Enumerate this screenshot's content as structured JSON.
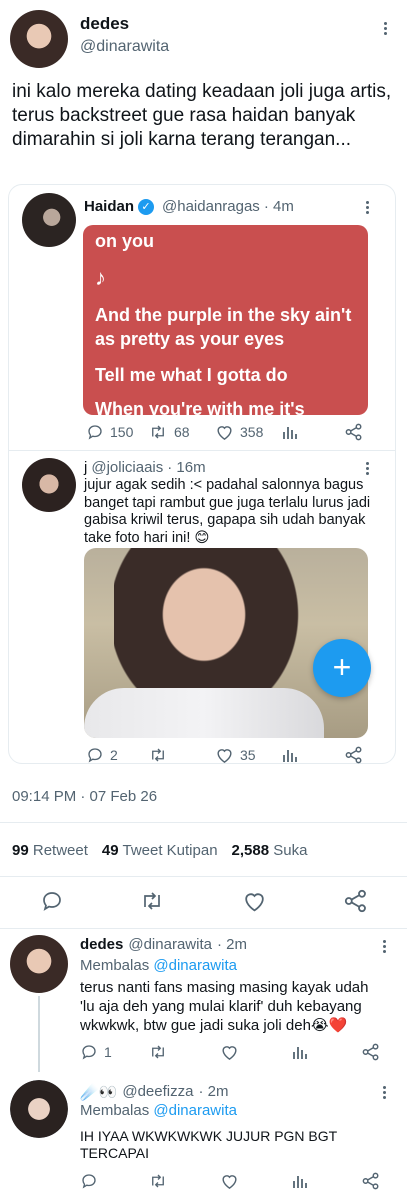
{
  "main_tweet": {
    "author_name": "dedes",
    "author_handle": "@dinarawita",
    "text": "ini kalo mereka dating keadaan joli juga artis, terus backstreet gue rasa haidan banyak dimarahin si joli karna terang terangan..."
  },
  "quote_card": {
    "tweet_1": {
      "author_name": "Haidan",
      "verified_icon": "verified-badge-icon",
      "author_handle": "@haidanragas",
      "time": "· 4m",
      "lyrics": [
        "on you",
        "♪",
        "And the purple in the sky ain't",
        "as pretty as your eyes",
        "Tell me what I gotta do",
        "When you're with me it's"
      ],
      "replies": "150",
      "retweets": "68",
      "likes": "358"
    },
    "tweet_2": {
      "author_name": "j",
      "author_handle": "@joliciaais",
      "time": "· 16m",
      "text": "jujur agak sedih :< padahal salonnya bagus banget tapi rambut gue juga terlalu lurus jadi gabisa kriwil terus, gapapa sih udah banyak take foto hari ini! 😊",
      "replies": "2",
      "likes": "35"
    }
  },
  "meta": {
    "timestamp": "09:14 PM · 07 Feb 26"
  },
  "stats": {
    "retweets_count": "99",
    "retweets_label": "Retweet",
    "quotes_count": "49",
    "quotes_label": "Tweet Kutipan",
    "likes_count": "2,588",
    "likes_label": "Suka"
  },
  "replies": [
    {
      "author_name": "dedes",
      "author_handle": "@dinarawita",
      "time": "· 2m",
      "replying_label": "Membalas",
      "replying_to": "@dinarawita",
      "text": "terus nanti fans masing masing kayak udah 'lu aja deh yang mulai klarif' duh kebayang wkwkwk, btw gue jadi suka joli deh😭❤️",
      "replies": "1"
    },
    {
      "author_name": "☄️👀",
      "author_handle": "@deefizza",
      "time": "· 2m",
      "replying_label": "Membalas",
      "replying_to": "@dinarawita",
      "text": "IH IYAA WKWKWKWK JUJUR PGN BGT TERCAPAI"
    }
  ],
  "colors": {
    "accent": "#1d9bf0",
    "text": "#0f1419",
    "muted": "#536471",
    "lyrics_card": "#c94f4f"
  }
}
